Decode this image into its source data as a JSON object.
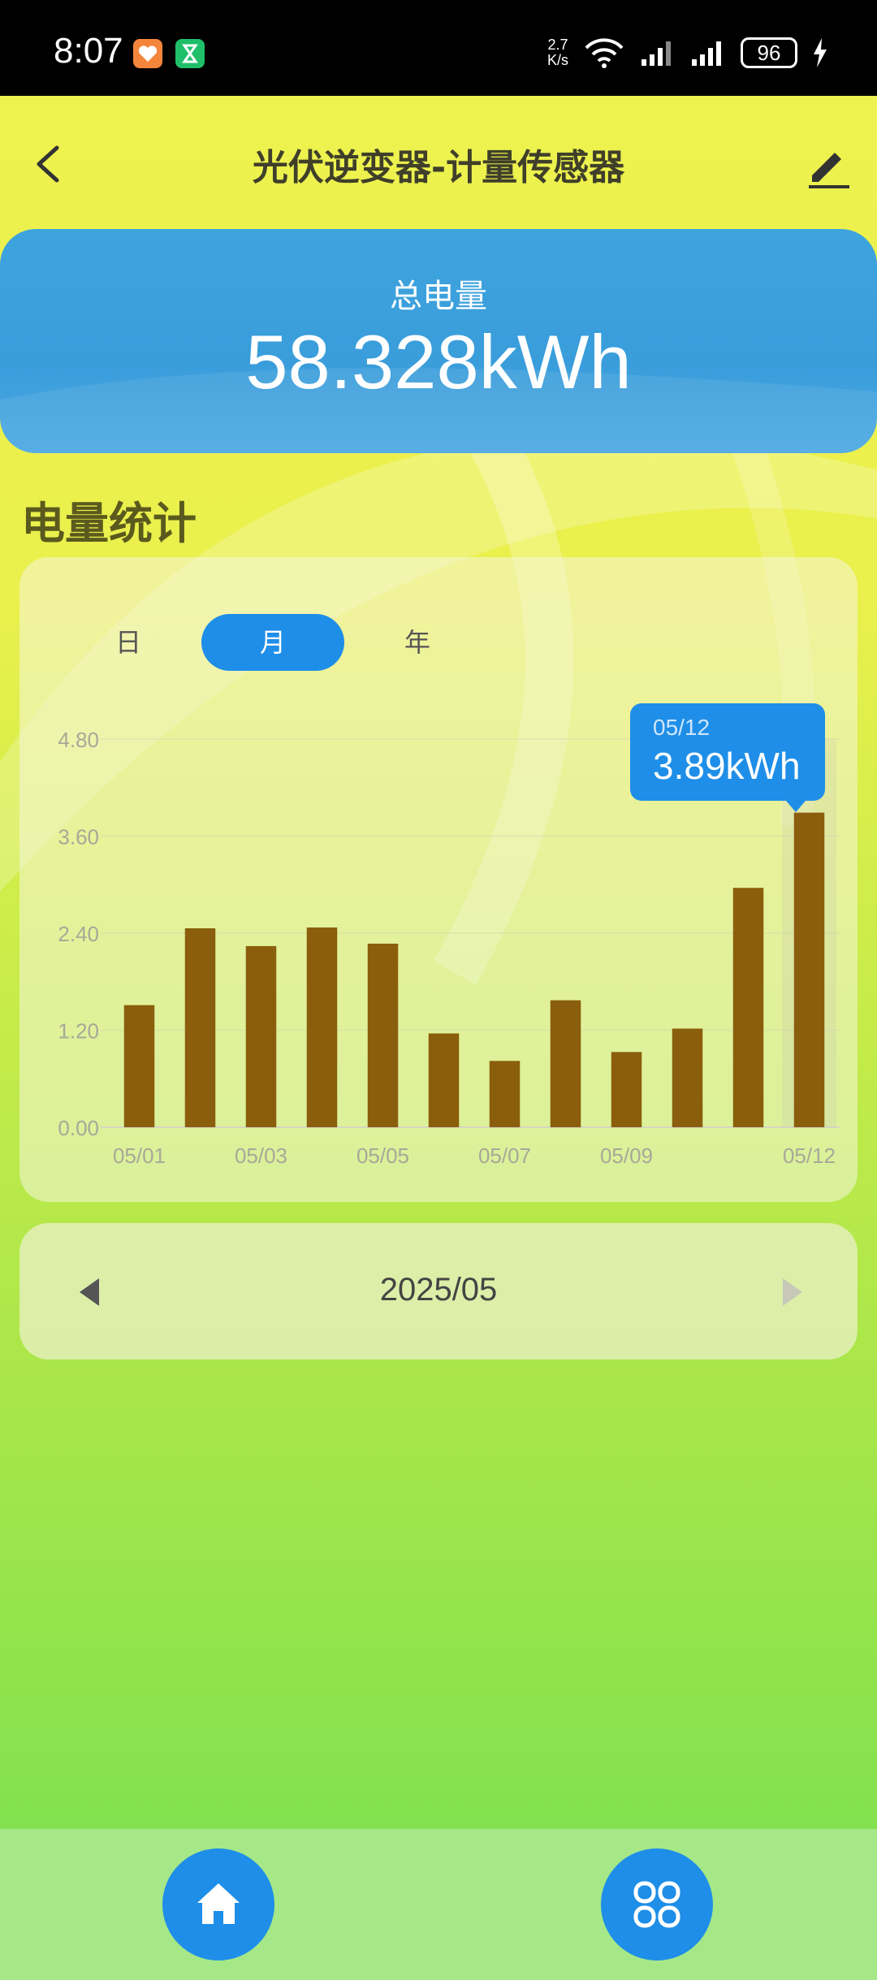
{
  "status_bar": {
    "time": "8:07",
    "net_speed_value": "2.7",
    "net_speed_unit": "K/s",
    "battery": "96",
    "icons": [
      "health-app-icon",
      "timer-app-icon",
      "wifi-icon",
      "signal-icon",
      "signal-icon",
      "battery-icon",
      "charging-icon"
    ]
  },
  "header": {
    "title": "光伏逆变器-计量传感器",
    "back_icon": "chevron-left-icon",
    "edit_icon": "pencil-icon"
  },
  "total": {
    "label": "总电量",
    "value": "58.328kWh"
  },
  "stats": {
    "section_title": "电量统计",
    "tabs": [
      {
        "label": "日",
        "active": false
      },
      {
        "label": "月",
        "active": true
      },
      {
        "label": "年",
        "active": false
      }
    ],
    "tooltip": {
      "date": "05/12",
      "value": "3.89kWh"
    }
  },
  "chart_data": {
    "type": "bar",
    "categories": [
      "05/01",
      "05/02",
      "05/03",
      "05/04",
      "05/05",
      "05/06",
      "05/07",
      "05/08",
      "05/09",
      "05/10",
      "05/11",
      "05/12"
    ],
    "x_tick_labels": [
      {
        "index": 0,
        "label": "05/01"
      },
      {
        "index": 2,
        "label": "05/03"
      },
      {
        "index": 4,
        "label": "05/05"
      },
      {
        "index": 6,
        "label": "05/07"
      },
      {
        "index": 8,
        "label": "05/09"
      },
      {
        "index": 11,
        "label": "05/12"
      }
    ],
    "values": [
      1.51,
      2.46,
      2.24,
      2.47,
      2.27,
      1.16,
      0.82,
      1.57,
      0.93,
      1.22,
      2.96,
      3.89
    ],
    "y_ticks": [
      "0.00",
      "1.20",
      "2.40",
      "3.60",
      "4.80"
    ],
    "ylim": [
      0,
      4.8
    ],
    "highlight_index": 11,
    "bar_color": "#8a5e0c",
    "grid": true
  },
  "month_nav": {
    "label": "2025/05",
    "prev_icon": "triangle-left-icon",
    "next_icon": "triangle-right-icon"
  },
  "bottom_nav": {
    "items": [
      "home-icon",
      "grid-apps-icon"
    ],
    "accent": "#1e8ee8"
  }
}
